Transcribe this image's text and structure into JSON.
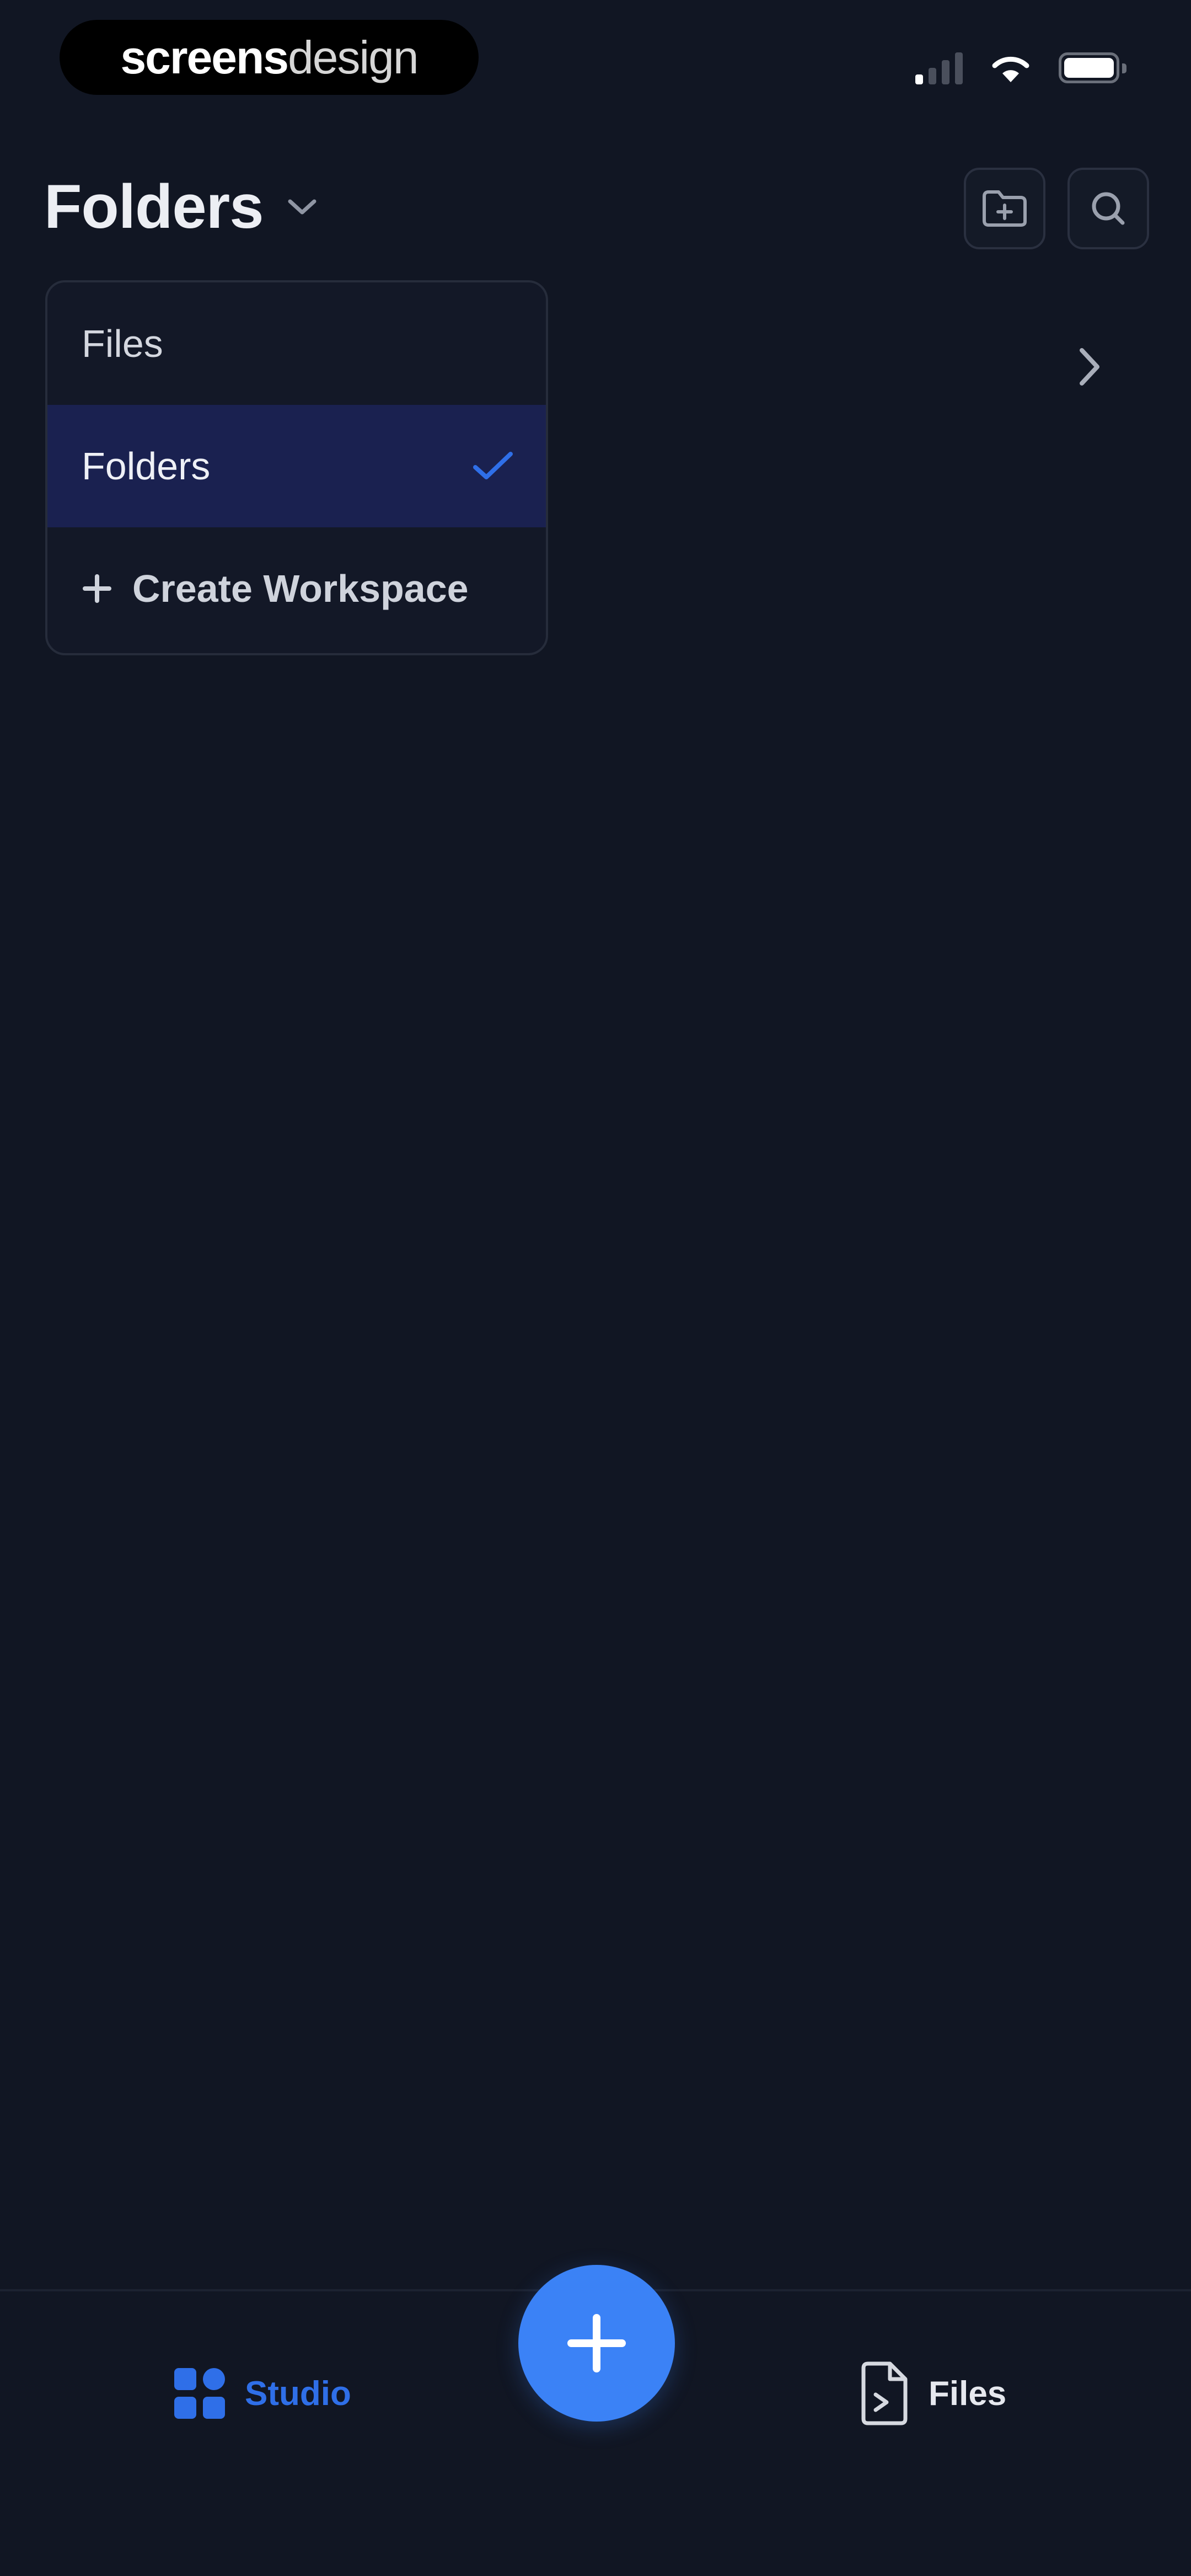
{
  "status_bar": {
    "brand_bold": "screens",
    "brand_light": "design"
  },
  "header": {
    "title": "Folders",
    "title_icon": "chevron-down-icon",
    "actions": [
      {
        "name": "new-folder-button",
        "icon": "folder-plus-icon"
      },
      {
        "name": "search-button",
        "icon": "search-icon"
      }
    ]
  },
  "dropdown": {
    "items": [
      {
        "label": "Files",
        "selected": false
      },
      {
        "label": "Folders",
        "selected": true
      },
      {
        "label": "Create Workspace",
        "icon": "plus-icon"
      }
    ]
  },
  "bottom_nav": {
    "tabs": [
      {
        "label": "Studio",
        "icon": "grid-icon",
        "active": true
      },
      {
        "label": "Files",
        "icon": "file-icon",
        "active": false
      }
    ],
    "fab_icon": "plus-icon"
  },
  "colors": {
    "background": "#111623",
    "accent": "#3b82f6",
    "selected_row": "#1a2150",
    "active_tab": "#2f6fe8"
  }
}
